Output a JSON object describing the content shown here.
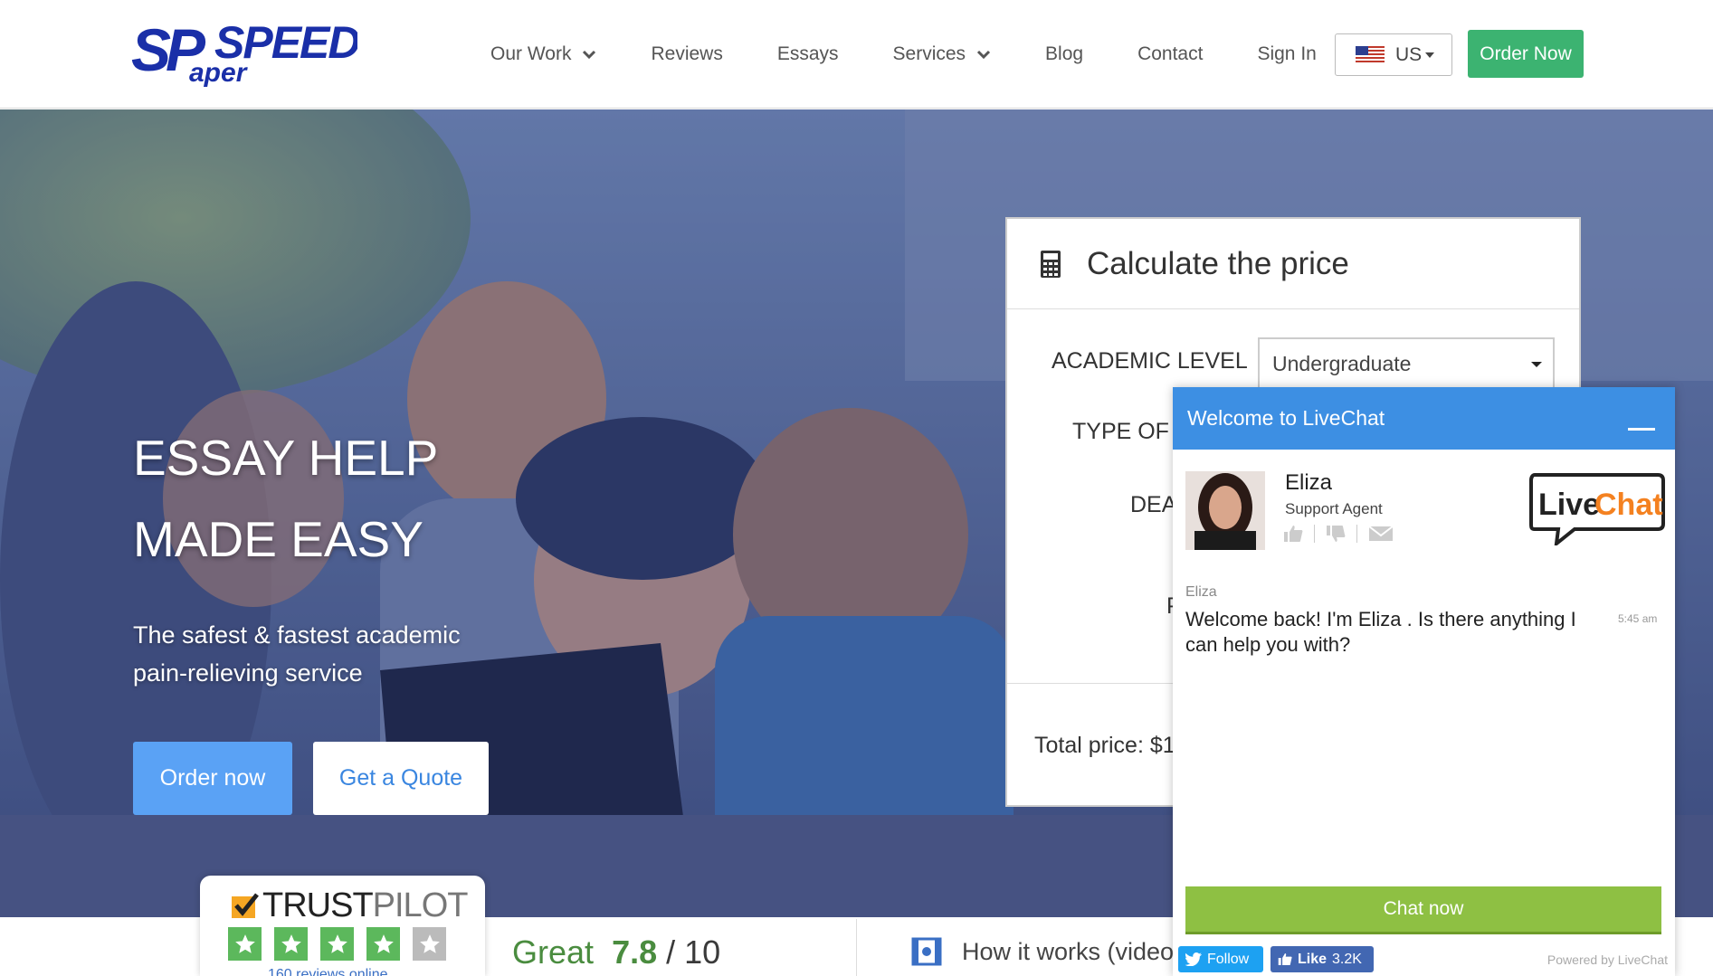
{
  "brand": {
    "logo_top": "SPEEDY",
    "logo_sub": "aper",
    "logo_initials": "SP"
  },
  "nav": [
    {
      "label": "Our Work",
      "has_dropdown": true
    },
    {
      "label": "Reviews",
      "has_dropdown": false
    },
    {
      "label": "Essays",
      "has_dropdown": false
    },
    {
      "label": "Services",
      "has_dropdown": true
    },
    {
      "label": "Blog",
      "has_dropdown": false
    },
    {
      "label": "Contact",
      "has_dropdown": false
    },
    {
      "label": "Sign In",
      "has_dropdown": false
    }
  ],
  "language": {
    "label": "US",
    "flag_icon": "us-flag-icon"
  },
  "header": {
    "order_label": "Order Now"
  },
  "hero": {
    "title_line1": "ESSAY HELP",
    "title_line2": "MADE EASY",
    "subtitle": "The safest & fastest academic pain-relieving service",
    "order_label": "Order now",
    "quote_label": "Get a Quote"
  },
  "calculator": {
    "title": "Calculate the price",
    "icon": "calculator-icon",
    "academic_level_label": "ACADEMIC LEVEL",
    "academic_level_value": "Undergraduate",
    "type_label": "TYPE OF P",
    "deadline_label": "DEA",
    "partial_label": "P",
    "total_label": "Total price: $1"
  },
  "trustpilot": {
    "brand_trust": "TRUST",
    "brand_pilot": "PILOT",
    "stars_filled": 4,
    "stars_total": 5,
    "reviews_text": "160 reviews online"
  },
  "rating": {
    "word": "Great",
    "score": "7.8",
    "out_of": "/ 10"
  },
  "how_it_works": {
    "label": "How it works (video)",
    "icon": "video-icon"
  },
  "livechat": {
    "header_title": "Welcome to LiveChat",
    "agent_name": "Eliza",
    "agent_role": "Support Agent",
    "logo_text_live": "Live",
    "logo_text_chat": "Chat",
    "message_author": "Eliza",
    "message_text": "Welcome back! I'm Eliza . Is there anything I can help you with?",
    "message_time": "5:45 am",
    "chat_now_label": "Chat now",
    "twitter_label": "Follow",
    "facebook_label": "Like",
    "facebook_count": "3.2K",
    "powered_by": "Powered by LiveChat"
  },
  "colors": {
    "brand_blue": "#1a2fa8",
    "accent_green": "#3cb371",
    "hero_button_blue": "#5aa2f5",
    "livechat_blue": "#3d8fe3",
    "chat_now_green": "#8ec043",
    "trustpilot_green": "#5cb85c"
  }
}
